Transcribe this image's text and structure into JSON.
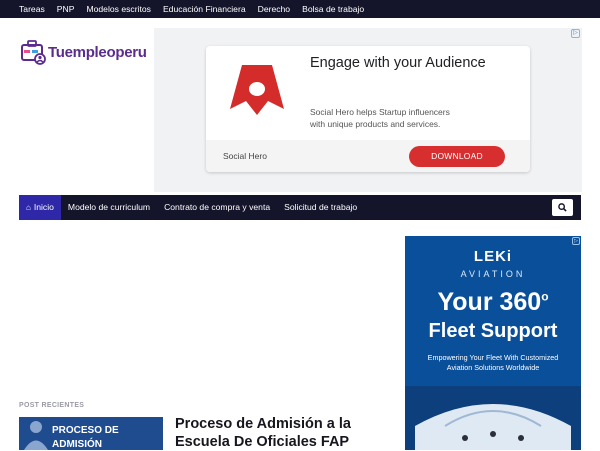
{
  "topbar": {
    "links": [
      "Tareas",
      "PNP",
      "Modelos escritos",
      "Educación Financiera",
      "Derecho",
      "Bolsa de trabajo"
    ]
  },
  "logo": {
    "text": "Tuempleoperu"
  },
  "ad": {
    "title": "Engage with your Audience",
    "description": "Social Hero helps Startup influencers with unique products and services.",
    "brand": "Social Hero",
    "cta": "DOWNLOAD",
    "cta_color": "#d72f2f"
  },
  "mainnav": {
    "items": [
      "Inicio",
      "Modelo de curriculum",
      "Contrato de compra y venta",
      "Solicitud de trabajo"
    ],
    "active_color": "#2e27a8"
  },
  "sidebar_ad": {
    "brand": "LEKi",
    "tagline": "AVIATION",
    "headline1": "Your 360",
    "headline1_sup": "o",
    "headline2": "Fleet Support",
    "body": "Empowering Your Fleet With Customized Aviation Solutions Worldwide"
  },
  "recent": {
    "label": "POST RECIENTES",
    "thumb_text": [
      "PROCESO DE",
      "ADMISIÓN"
    ],
    "title": "Proceso de Admisión a la Escuela De Oficiales FAP"
  },
  "colors": {
    "dark_bar": "#14152b",
    "logo_purple": "#5b2c8e"
  }
}
